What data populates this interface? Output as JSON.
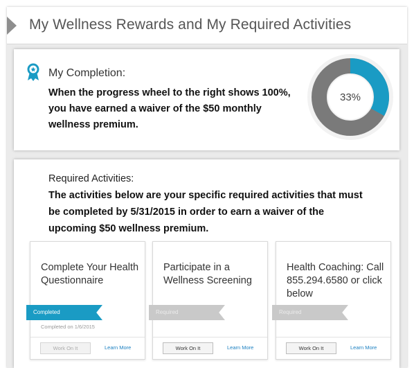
{
  "header": {
    "title": "My Wellness Rewards and My Required Activities"
  },
  "completion": {
    "label": "My Completion:",
    "text": "When the progress wheel to the right shows 100%, you have earned a waiver of the $50 monthly wellness premium.",
    "progress_percent": 33,
    "progress_label": "33%"
  },
  "required": {
    "label": "Required Activities:",
    "text": "The activities below are your specific required activities that must be completed by 5/31/2015 in order to earn a waiver of the upcoming $50 wellness premium."
  },
  "cards": [
    {
      "title": "Complete Your Health Questionnaire",
      "status": "Completed",
      "date": "Completed on 1/6/2015",
      "button": "Work On It",
      "link": "Learn More"
    },
    {
      "title": "Participate in a Wellness Screening",
      "status": "Required",
      "button": "Work On It",
      "link": "Learn More"
    },
    {
      "title": "Health Coaching: Call 855.294.6580 or click below",
      "status": "Required",
      "button": "Work On It",
      "link": "Learn More"
    }
  ],
  "colors": {
    "accent": "#1a9bc4",
    "wheel_track": "#7a7a7a",
    "link": "#1a7fc1"
  }
}
